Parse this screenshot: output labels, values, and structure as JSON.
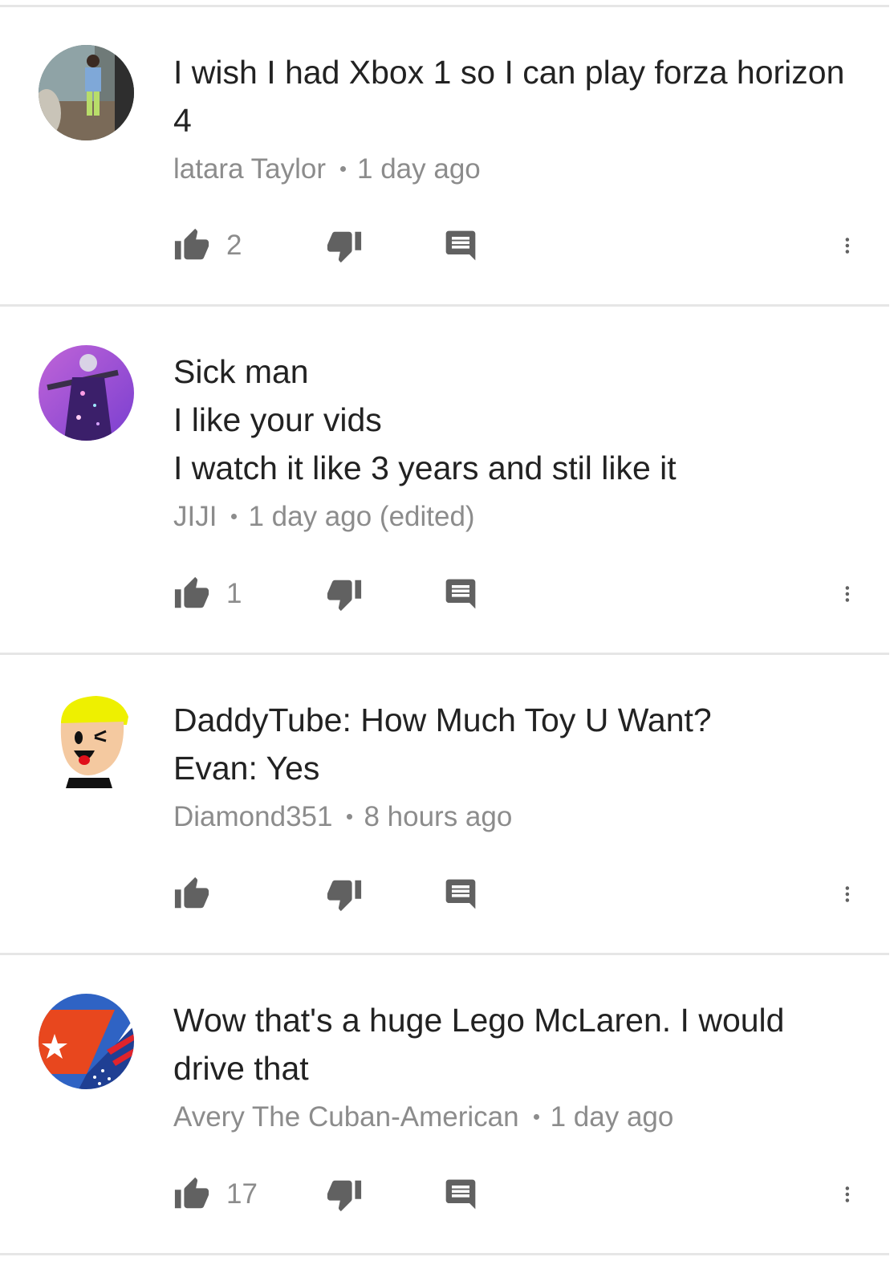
{
  "comments": [
    {
      "text": "I wish I had Xbox 1 so I can play forza horizon\n4",
      "author": "latara Taylor",
      "time": "1 day ago",
      "likes": "2",
      "avatar": "photo-child-avatar"
    },
    {
      "text": "Sick man\nI like your vids\nI watch it like 3 years and stil like it",
      "author": "JIJI",
      "time": "1 day ago (edited)",
      "likes": "1",
      "avatar": "galaxy-character-avatar"
    },
    {
      "text": "DaddyTube: How Much Toy U Want?\nEvan: Yes",
      "author": "Diamond351",
      "time": "8 hours ago",
      "likes": "",
      "avatar": "cartoon-face-avatar"
    },
    {
      "text": "Wow that's a huge Lego McLaren. I would\ndrive that",
      "author": "Avery The Cuban-American",
      "time": "1 day ago",
      "likes": "17",
      "avatar": "cuba-usa-flag-avatar"
    }
  ],
  "icons": {
    "like": "thumbs-up-icon",
    "dislike": "thumbs-down-icon",
    "reply": "reply-comment-icon",
    "more": "more-vertical-icon"
  },
  "colors": {
    "text": "#222222",
    "meta": "#8c8c8c",
    "icon": "#616161",
    "divider": "#e6e6e6"
  }
}
